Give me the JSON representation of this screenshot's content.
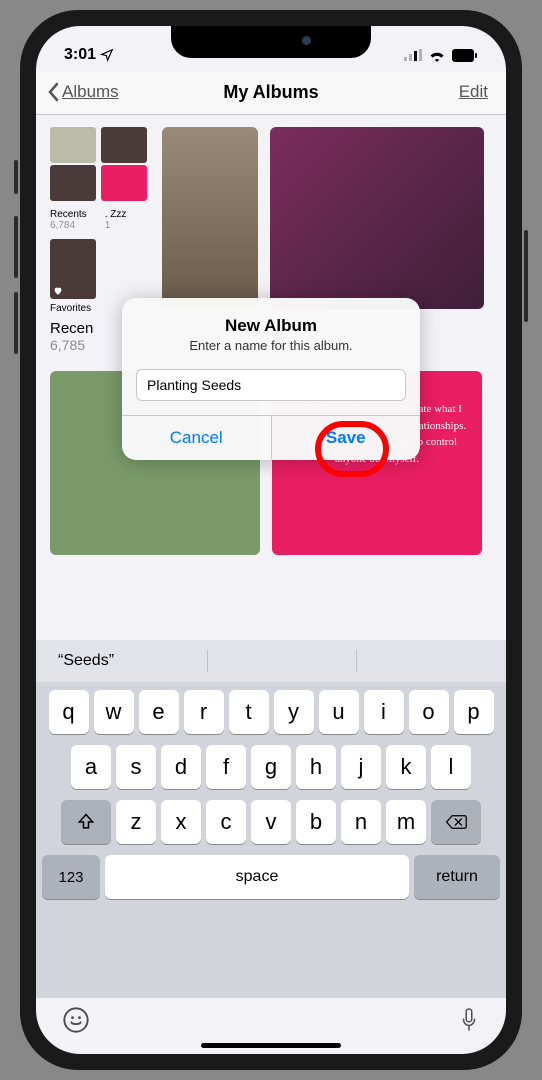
{
  "status": {
    "time": "3:01"
  },
  "nav": {
    "back": "Albums",
    "title": "My Albums",
    "edit": "Edit"
  },
  "albums": {
    "recents_mini": {
      "label": "Recents",
      "count": "6,784"
    },
    "zzz": {
      "label": ". Zzz",
      "count": "1"
    },
    "favorites": {
      "label": "Favorites"
    },
    "recents_label": "Recen",
    "recents_count": "6,785"
  },
  "quote": "—My boundaries communicate what I want and don't want in my relationships. They are never an attempt to control anyone but myself.",
  "modal": {
    "title": "New Album",
    "message": "Enter a name for this album.",
    "input_value": "Planting Seeds",
    "cancel": "Cancel",
    "save": "Save"
  },
  "keyboard": {
    "suggestion": "“Seeds”",
    "row1": [
      "q",
      "w",
      "e",
      "r",
      "t",
      "y",
      "u",
      "i",
      "o",
      "p"
    ],
    "row2": [
      "a",
      "s",
      "d",
      "f",
      "g",
      "h",
      "j",
      "k",
      "l"
    ],
    "row3": [
      "z",
      "x",
      "c",
      "v",
      "b",
      "n",
      "m"
    ],
    "num": "123",
    "space": "space",
    "return": "return"
  }
}
